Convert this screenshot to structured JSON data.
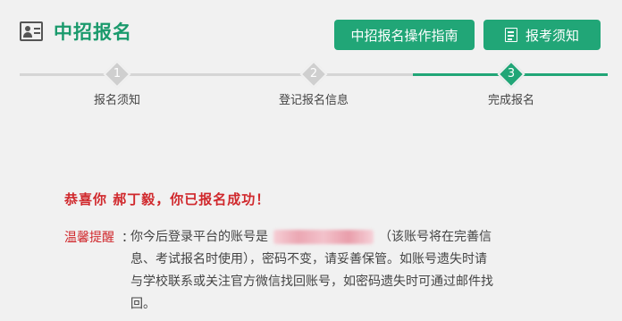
{
  "header": {
    "title": "中招报名",
    "icon": "id-card-icon",
    "guide_button": "中招报名操作指南",
    "notice_button": "报考须知",
    "accent": "#21a677"
  },
  "steps": [
    {
      "number": "1",
      "label": "报名须知",
      "state": "done"
    },
    {
      "number": "2",
      "label": "登记报名信息",
      "state": "done"
    },
    {
      "number": "3",
      "label": "完成报名",
      "state": "active"
    }
  ],
  "result": {
    "congrats": "恭喜你 郝丁毅，你已报名成功！",
    "tip_label": "温馨提醒",
    "tip_colon": "：",
    "tip_lines": [
      "你今后登录平台的账号是",
      "（该账号将在完善信",
      "息、考试报名时使用），密码不变，请妥善保管。如账号遗失时请",
      "与学校联系或关注官方微信找回账号，如密码遗失时可通过邮件找",
      "回。"
    ]
  }
}
